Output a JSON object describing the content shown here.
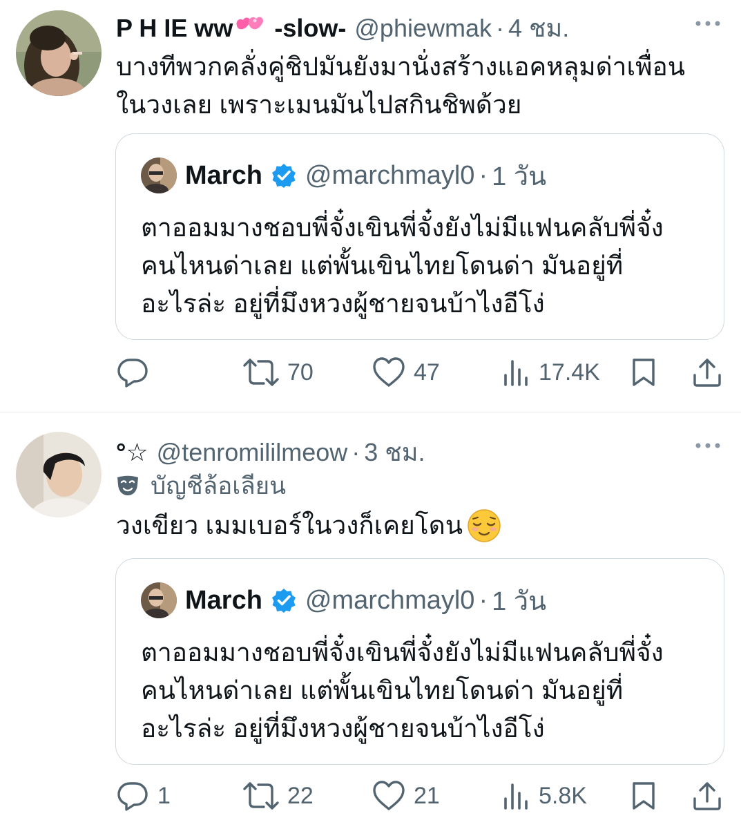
{
  "colors": {
    "text": "#0f1419",
    "secondary": "#536471",
    "border": "#cfd9de",
    "verified": "#1d9bf0"
  },
  "tweets": [
    {
      "author_name": "P H IE ww",
      "author_name_extra": "-slow-",
      "handle": "@phiewmak",
      "separator": "·",
      "time": "4 ชม.",
      "text_lines": [
        "บางทีพวกคลั่งคู่ชิปมันยังมานั่งสร้างแอคหลุมด่าเพื่อน",
        "ในวงเลย เพราะเมนมันไปสกินชิพด้วย"
      ],
      "quote": {
        "name": "March",
        "handle": "@marchmayl0",
        "separator": "·",
        "time": "1 วัน",
        "text_lines": [
          "ตาออมมางชอบพี่จั๋งเขินพี่จั๋งยังไม่มีแฟนคลับพี่จั๋ง",
          "คนไหนด่าเลย แต่พั้นเขินไทยโดนด่า มันอยู่ที่",
          "อะไรล่ะ อยู่ที่มึงหวงผู้ชายจนบ้าไงอีโง่"
        ]
      },
      "stats": {
        "replies": "",
        "reposts": "70",
        "likes": "47",
        "views": "17.4K"
      }
    },
    {
      "author_name": "°☆",
      "handle": "@tenromililmeow",
      "separator": "·",
      "time": "3 ชม.",
      "parody_label": "บัญชีล้อเลียน",
      "text": "วงเขียว เมมเบอร์ในวงก็เคยโดน",
      "quote": {
        "name": "March",
        "handle": "@marchmayl0",
        "separator": "·",
        "time": "1 วัน",
        "text_lines": [
          "ตาออมมางชอบพี่จั๋งเขินพี่จั๋งยังไม่มีแฟนคลับพี่จั๋ง",
          "คนไหนด่าเลย แต่พั้นเขินไทยโดนด่า มันอยู่ที่",
          "อะไรล่ะ อยู่ที่มึงหวงผู้ชายจนบ้าไงอีโง่"
        ]
      },
      "stats": {
        "replies": "1",
        "reposts": "22",
        "likes": "21",
        "views": "5.8K"
      }
    }
  ],
  "icons": [
    "more-icon",
    "reply-icon",
    "repost-icon",
    "like-icon",
    "views-icon",
    "bookmark-icon",
    "share-icon",
    "verified-icon",
    "parody-mask-icon",
    "heart-emoji",
    "relieved-emoji"
  ]
}
